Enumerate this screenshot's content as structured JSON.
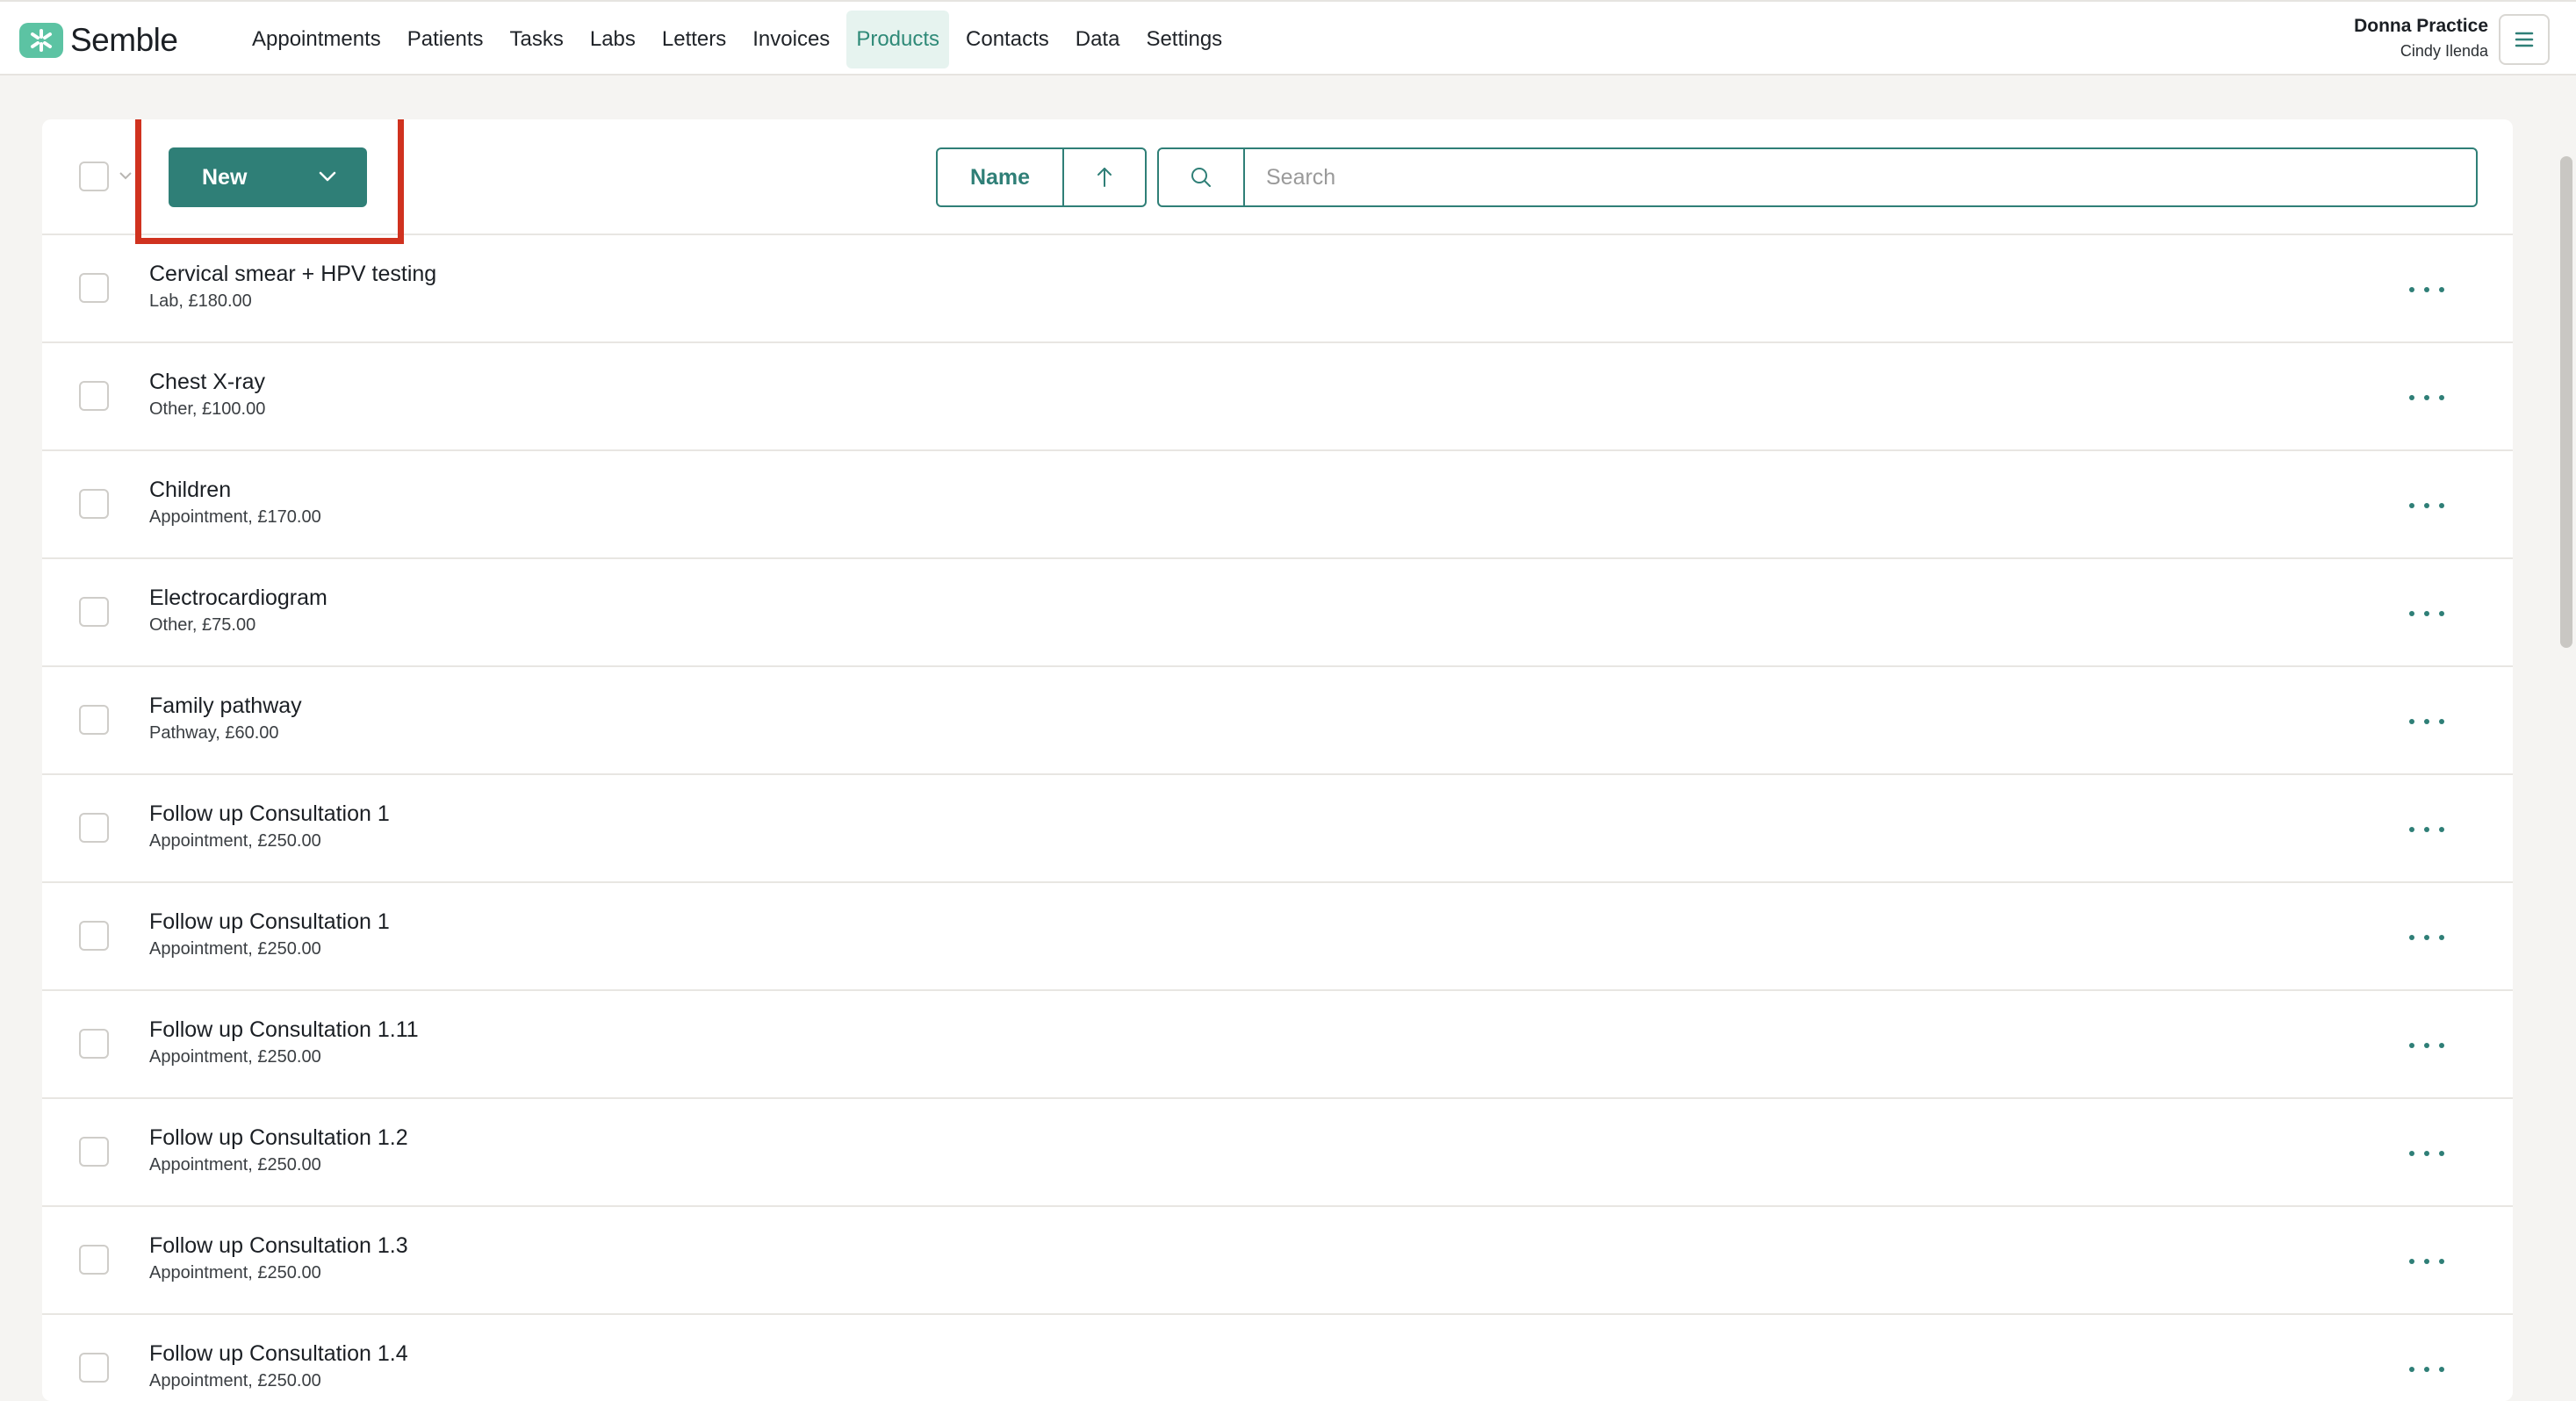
{
  "app": {
    "name": "Semble"
  },
  "nav": {
    "items": [
      {
        "label": "Appointments"
      },
      {
        "label": "Patients"
      },
      {
        "label": "Tasks"
      },
      {
        "label": "Labs"
      },
      {
        "label": "Letters"
      },
      {
        "label": "Invoices"
      },
      {
        "label": "Products",
        "active": true
      },
      {
        "label": "Contacts"
      },
      {
        "label": "Data"
      },
      {
        "label": "Settings"
      }
    ]
  },
  "user": {
    "practice": "Donna Practice",
    "name": "Cindy Ilenda"
  },
  "toolbar": {
    "new_label": "New",
    "sort_label": "Name",
    "search_placeholder": "Search"
  },
  "colors": {
    "accent": "#2f7f77",
    "highlight": "#d0321f",
    "logo": "#5cc3a3"
  },
  "products": [
    {
      "title": "Cervical smear + HPV testing",
      "subtitle": "Lab, £180.00"
    },
    {
      "title": "Chest X-ray",
      "subtitle": "Other, £100.00"
    },
    {
      "title": "Children",
      "subtitle": "Appointment, £170.00"
    },
    {
      "title": "Electrocardiogram",
      "subtitle": "Other, £75.00"
    },
    {
      "title": "Family pathway",
      "subtitle": "Pathway, £60.00"
    },
    {
      "title": "Follow up Consultation 1",
      "subtitle": "Appointment, £250.00"
    },
    {
      "title": "Follow up Consultation 1",
      "subtitle": "Appointment, £250.00"
    },
    {
      "title": "Follow up Consultation 1.11",
      "subtitle": "Appointment, £250.00"
    },
    {
      "title": "Follow up Consultation 1.2",
      "subtitle": "Appointment, £250.00"
    },
    {
      "title": "Follow up Consultation 1.3",
      "subtitle": "Appointment, £250.00"
    },
    {
      "title": "Follow up Consultation 1.4",
      "subtitle": "Appointment, £250.00"
    }
  ]
}
